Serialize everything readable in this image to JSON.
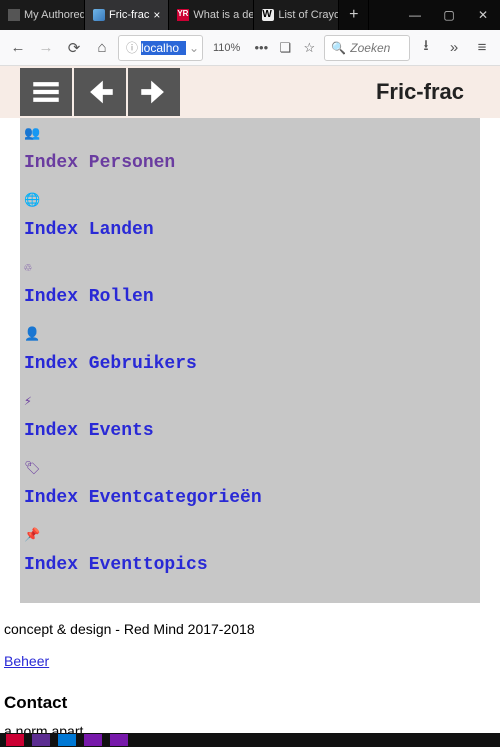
{
  "browser": {
    "tabs": [
      {
        "label": "My Authored P…"
      },
      {
        "label": "Fric-frac"
      },
      {
        "label": "What is a de…"
      },
      {
        "label": "List of Crayo…"
      }
    ],
    "address": "localho",
    "zoom": "110%",
    "search_placeholder": "Zoeken"
  },
  "header": {
    "title": "Fric-frac"
  },
  "menu": [
    {
      "icon": "👥",
      "label": "Index Personen",
      "visited": true
    },
    {
      "icon": "🌐",
      "label": "Index Landen",
      "visited": false
    },
    {
      "icon": "♲",
      "label": "Index Rollen",
      "visited": false
    },
    {
      "icon": "👤",
      "label": "Index Gebruikers",
      "visited": false
    },
    {
      "icon": "⚡",
      "label": "Index Events",
      "visited": false
    },
    {
      "icon": "🏷",
      "label": "Index Eventcategorieën",
      "visited": false
    },
    {
      "icon": "📌",
      "label": "Index Eventtopics",
      "visited": false
    }
  ],
  "footer": {
    "credit": "concept & design - Red Mind 2017-2018",
    "beheer": "Beheer",
    "contact_h": "Contact",
    "contact_t": "a norm apart"
  }
}
